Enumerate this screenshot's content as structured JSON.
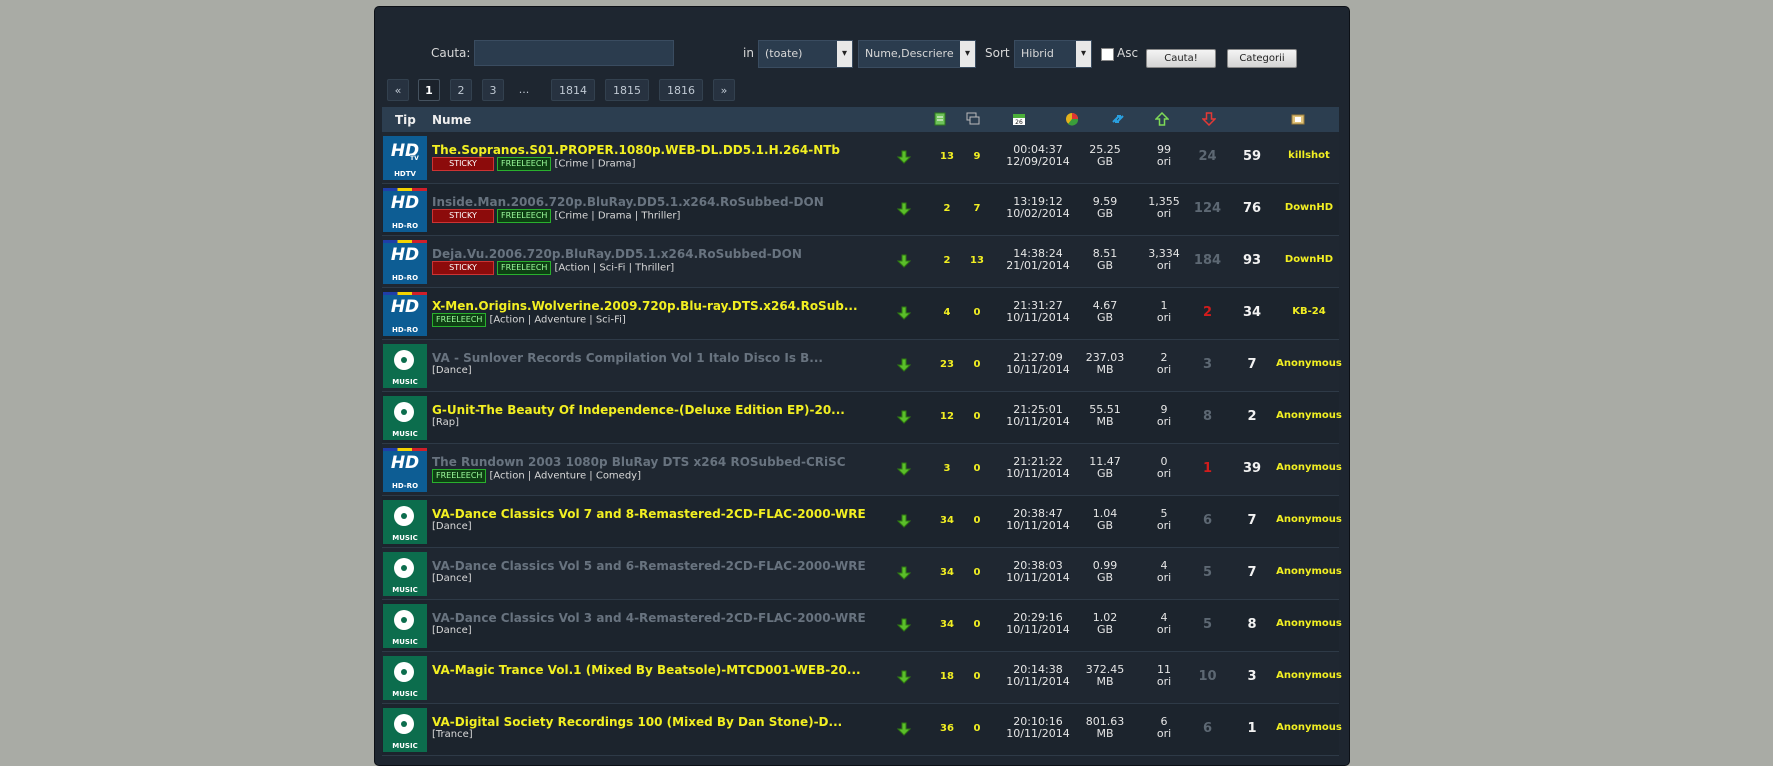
{
  "search": {
    "label": "Cauta:",
    "value": "",
    "in_label": "in",
    "category_select": "(toate)",
    "field_select": "Nume,Descriere",
    "sort_label": "Sort",
    "sort_select": "Hibrid",
    "asc_label": "Asc",
    "asc_checked": false,
    "search_button": "Cauta!",
    "categories_button": "Categorii"
  },
  "pagination": {
    "prev": "«",
    "next": "»",
    "pages": [
      "1",
      "2",
      "3",
      "...",
      "1814",
      "1815",
      "1816"
    ],
    "current": "1"
  },
  "table": {
    "headers": {
      "tip": "Tip",
      "nume": "Nume"
    },
    "header_icons": [
      "files-icon",
      "comments-icon",
      "date-icon",
      "size-icon",
      "snatched-icon",
      "seeders-icon",
      "leechers-icon",
      "uploader-icon"
    ],
    "rows": [
      {
        "cat": "hd",
        "cat_label": "HDTV",
        "flag": false,
        "tv": true,
        "title": "The.Sopranos.S01.PROPER.1080p.WEB-DL.DD5.1.H.264-NTb",
        "title_color": "yellow",
        "sticky": "STICKY",
        "free": "FREELEECH",
        "genre": "[Crime | Drama]",
        "files": "13",
        "comments": "9",
        "time": "00:04:37",
        "date": "12/09/2014",
        "size": "25.25",
        "unit": "GB",
        "snatched": "99",
        "snatched_unit": "ori",
        "seeders": "24",
        "seed_red": false,
        "leechers": "59",
        "uploader": "killshot"
      },
      {
        "cat": "hd",
        "cat_label": "HD-RO",
        "flag": true,
        "tv": false,
        "title": "Inside.Man.2006.720p.BluRay.DD5.1.x264.RoSubbed-DON",
        "title_color": "gray",
        "sticky": "STICKY",
        "free": "FREELEECH",
        "genre": "[Crime | Drama | Thriller]",
        "files": "2",
        "comments": "7",
        "time": "13:19:12",
        "date": "10/02/2014",
        "size": "9.59",
        "unit": "GB",
        "snatched": "1,355",
        "snatched_unit": "ori",
        "seeders": "124",
        "seed_red": false,
        "leechers": "76",
        "uploader": "DownHD"
      },
      {
        "cat": "hd",
        "cat_label": "HD-RO",
        "flag": true,
        "tv": false,
        "title": "Deja.Vu.2006.720p.BluRay.DD5.1.x264.RoSubbed-DON",
        "title_color": "gray",
        "sticky": "STICKY",
        "free": "FREELEECH",
        "genre": "[Action | Sci-Fi | Thriller]",
        "files": "2",
        "comments": "13",
        "time": "14:38:24",
        "date": "21/01/2014",
        "size": "8.51",
        "unit": "GB",
        "snatched": "3,334",
        "snatched_unit": "ori",
        "seeders": "184",
        "seed_red": false,
        "leechers": "93",
        "uploader": "DownHD"
      },
      {
        "cat": "hd",
        "cat_label": "HD-RO",
        "flag": true,
        "tv": false,
        "title": "X-Men.Origins.Wolverine.2009.720p.Blu-ray.DTS.x264.RoSub...",
        "title_color": "yellow",
        "sticky": "",
        "free": "FREELEECH",
        "genre": "[Action | Adventure | Sci-Fi]",
        "files": "4",
        "comments": "0",
        "time": "21:31:27",
        "date": "10/11/2014",
        "size": "4.67",
        "unit": "GB",
        "snatched": "1",
        "snatched_unit": "ori",
        "seeders": "2",
        "seed_red": true,
        "leechers": "34",
        "uploader": "KB-24"
      },
      {
        "cat": "music",
        "cat_label": "MUSIC",
        "flag": false,
        "tv": false,
        "title": "VA - Sunlover Records Compilation Vol 1 Italo Disco Is B...",
        "title_color": "gray",
        "sticky": "",
        "free": "",
        "genre": "[Dance]",
        "files": "23",
        "comments": "0",
        "time": "21:27:09",
        "date": "10/11/2014",
        "size": "237.03",
        "unit": "MB",
        "snatched": "2",
        "snatched_unit": "ori",
        "seeders": "3",
        "seed_red": false,
        "leechers": "7",
        "uploader": "Anonymous"
      },
      {
        "cat": "music",
        "cat_label": "MUSIC",
        "flag": false,
        "tv": false,
        "title": "G-Unit-The Beauty Of Independence-(Deluxe Edition EP)-20...",
        "title_color": "yellow",
        "sticky": "",
        "free": "",
        "genre": "[Rap]",
        "files": "12",
        "comments": "0",
        "time": "21:25:01",
        "date": "10/11/2014",
        "size": "55.51",
        "unit": "MB",
        "snatched": "9",
        "snatched_unit": "ori",
        "seeders": "8",
        "seed_red": false,
        "leechers": "2",
        "uploader": "Anonymous"
      },
      {
        "cat": "hd",
        "cat_label": "HD-RO",
        "flag": true,
        "tv": false,
        "title": "The Rundown 2003 1080p BluRay DTS x264 ROSubbed-CRiSC",
        "title_color": "gray",
        "sticky": "",
        "free": "FREELEECH",
        "genre": "[Action | Adventure | Comedy]",
        "files": "3",
        "comments": "0",
        "time": "21:21:22",
        "date": "10/11/2014",
        "size": "11.47",
        "unit": "GB",
        "snatched": "0",
        "snatched_unit": "ori",
        "seeders": "1",
        "seed_red": true,
        "leechers": "39",
        "uploader": "Anonymous"
      },
      {
        "cat": "music",
        "cat_label": "MUSIC",
        "flag": false,
        "tv": false,
        "title": "VA-Dance Classics Vol 7 and 8-Remastered-2CD-FLAC-2000-WRE",
        "title_color": "yellow",
        "sticky": "",
        "free": "",
        "genre": "[Dance]",
        "files": "34",
        "comments": "0",
        "time": "20:38:47",
        "date": "10/11/2014",
        "size": "1.04",
        "unit": "GB",
        "snatched": "5",
        "snatched_unit": "ori",
        "seeders": "6",
        "seed_red": false,
        "leechers": "7",
        "uploader": "Anonymous"
      },
      {
        "cat": "music",
        "cat_label": "MUSIC",
        "flag": false,
        "tv": false,
        "title": "VA-Dance Classics Vol 5 and 6-Remastered-2CD-FLAC-2000-WRE",
        "title_color": "gray",
        "sticky": "",
        "free": "",
        "genre": "[Dance]",
        "files": "34",
        "comments": "0",
        "time": "20:38:03",
        "date": "10/11/2014",
        "size": "0.99",
        "unit": "GB",
        "snatched": "4",
        "snatched_unit": "ori",
        "seeders": "5",
        "seed_red": false,
        "leechers": "7",
        "uploader": "Anonymous"
      },
      {
        "cat": "music",
        "cat_label": "MUSIC",
        "flag": false,
        "tv": false,
        "title": "VA-Dance Classics Vol 3 and 4-Remastered-2CD-FLAC-2000-WRE",
        "title_color": "gray",
        "sticky": "",
        "free": "",
        "genre": "[Dance]",
        "files": "34",
        "comments": "0",
        "time": "20:29:16",
        "date": "10/11/2014",
        "size": "1.02",
        "unit": "GB",
        "snatched": "4",
        "snatched_unit": "ori",
        "seeders": "5",
        "seed_red": false,
        "leechers": "8",
        "uploader": "Anonymous"
      },
      {
        "cat": "music",
        "cat_label": "MUSIC",
        "flag": false,
        "tv": false,
        "title": "VA-Magic Trance Vol.1 (Mixed By Beatsole)-MTCD001-WEB-20...",
        "title_color": "yellow",
        "sticky": "",
        "free": "",
        "genre": "",
        "files": "18",
        "comments": "0",
        "time": "20:14:38",
        "date": "10/11/2014",
        "size": "372.45",
        "unit": "MB",
        "snatched": "11",
        "snatched_unit": "ori",
        "seeders": "10",
        "seed_red": false,
        "leechers": "3",
        "uploader": "Anonymous"
      },
      {
        "cat": "music",
        "cat_label": "MUSIC",
        "flag": false,
        "tv": false,
        "title": "VA-Digital Society Recordings 100 (Mixed By Dan Stone)-D...",
        "title_color": "yellow",
        "sticky": "",
        "free": "",
        "genre": "[Trance]",
        "files": "36",
        "comments": "0",
        "time": "20:10:16",
        "date": "10/11/2014",
        "size": "801.63",
        "unit": "MB",
        "snatched": "6",
        "snatched_unit": "ori",
        "seeders": "6",
        "seed_red": false,
        "leechers": "1",
        "uploader": "Anonymous"
      }
    ]
  }
}
